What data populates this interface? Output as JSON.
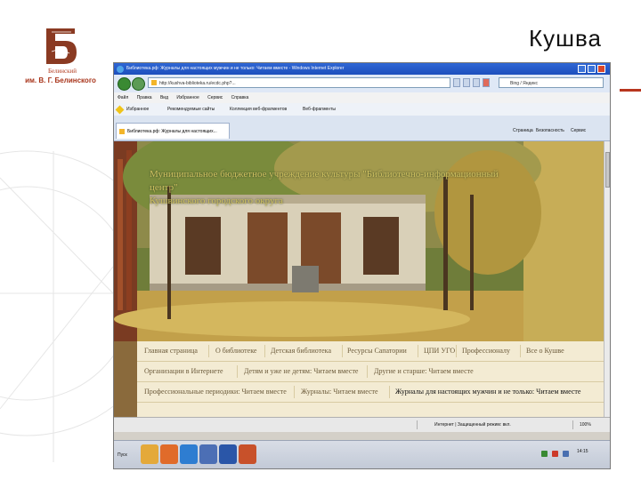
{
  "slide": {
    "title": "Кушва",
    "logo_caption": "Белинский",
    "logo_sub": "им. В. Г. Белинского",
    "colors": {
      "accent_red": "#b8361e",
      "logo_brown": "#8a3a22"
    }
  },
  "browser": {
    "window_title": "Библиотека.рф: Журналы для настоящих мужчин и не только: Читаем вместе - Windows Internet Explorer",
    "address": "http://kushva-biblioteka.ru/ecdc.php?...",
    "search_placeholder": "Bing / Яндекс",
    "menu": [
      "Файл",
      "Правка",
      "Вид",
      "Избранное",
      "Сервис",
      "Справка"
    ],
    "favorites": [
      {
        "label": "Избранное",
        "icon": "star-icon"
      },
      {
        "label": "Рекомендуемые сайты",
        "icon": "page-icon"
      },
      {
        "label": "Коллекция веб-фрагментов",
        "icon": "page-icon"
      },
      {
        "label": "Веб-фрагменты",
        "icon": "page-icon"
      }
    ],
    "tab_title": "Библиотека.рф: Журналы для настоящих...",
    "commands": [
      "Страница",
      "Безопасность",
      "Сервис"
    ],
    "status": "Интернет | Защищенный режим: вкл.",
    "zoom": "100%"
  },
  "site": {
    "heading_line1": "Муниципальное бюджетное учреждение культуры \"Библиотечно-информационный центр\"",
    "heading_line2": "Кушвинского городского округа",
    "nav_rows": [
      [
        "Главная страница",
        "О библиотеке",
        "Детская библиотека",
        "Ресурсы Сапатории",
        "ЦПИ УГО",
        "Профессионалу",
        "Все о Кушве"
      ],
      [
        "Организации в Интернете",
        "Детям и уже не детям: Читаем вместе",
        "Другие и старше: Читаем вместе"
      ],
      [
        "Профессиональные периодики: Читаем вместе",
        "Журналы: Читаем вместе",
        "Журналы для настоящих мужчин и не только: Читаем вместе"
      ]
    ],
    "active_item": "Журналы для настоящих мужчин и не только: Читаем вместе"
  },
  "taskbar": {
    "start_label": "Пуск",
    "apps": [
      "explorer-icon",
      "firefox-icon",
      "media-icon",
      "ie-icon",
      "internet-icon",
      "word-icon",
      "powerpoint-icon"
    ],
    "clock": "14:15"
  }
}
